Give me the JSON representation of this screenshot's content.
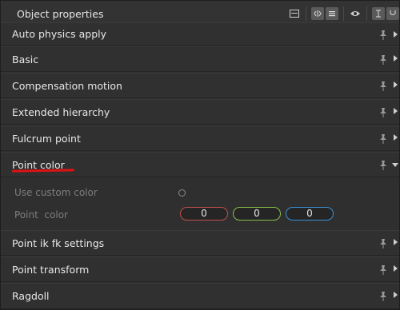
{
  "window": {
    "title": "Object properties"
  },
  "toolbar": {
    "icons": [
      "panel-icon",
      "code-icon",
      "list-icon",
      "eye-icon",
      "text-cursor-icon",
      "underline-icon"
    ]
  },
  "rows": [
    {
      "label": "Auto physics apply",
      "expanded": false
    },
    {
      "label": "Basic",
      "expanded": false
    },
    {
      "label": "Compensation motion",
      "expanded": false
    },
    {
      "label": "Extended hierarchy",
      "expanded": false
    },
    {
      "label": "Fulcrum point",
      "expanded": false
    },
    {
      "label": "Point color",
      "expanded": true
    },
    {
      "label": "Point ik fk settings",
      "expanded": false
    },
    {
      "label": "Point transform",
      "expanded": false
    },
    {
      "label": "Ragdoll",
      "expanded": false
    }
  ],
  "point_color": {
    "use_custom_color_label": "Use custom color",
    "point_color_label": "Point  color",
    "values": [
      {
        "value": "0",
        "color": "#c0504d"
      },
      {
        "value": "0",
        "color": "#8bbd4a"
      },
      {
        "value": "0",
        "color": "#3b8fd4"
      }
    ]
  },
  "colors": {
    "highlight_underline": "#e01212",
    "panel_bg": "#2f2f2f"
  }
}
